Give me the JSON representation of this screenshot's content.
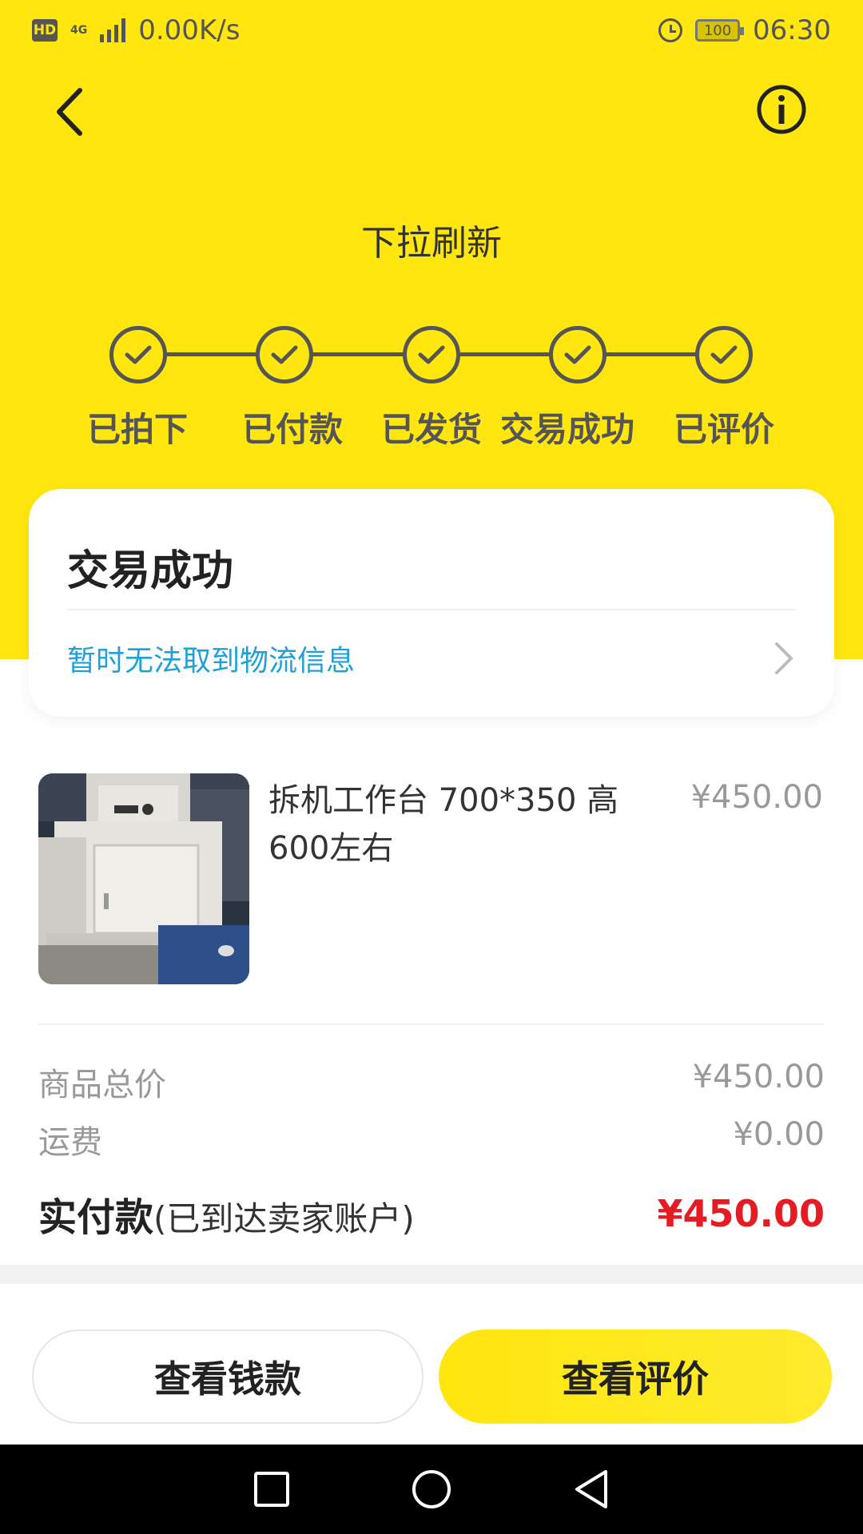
{
  "status_bar": {
    "hd": "HD",
    "network": "4G",
    "speed": "0.00K/s",
    "battery": "100",
    "time": "06:30"
  },
  "header": {
    "refresh_hint": "下拉刷新"
  },
  "progress": {
    "steps": [
      {
        "label": "已拍下",
        "done": true
      },
      {
        "label": "已付款",
        "done": true
      },
      {
        "label": "已发货",
        "done": true
      },
      {
        "label": "交易成功",
        "done": true
      },
      {
        "label": "已评价",
        "done": true
      }
    ]
  },
  "status_card": {
    "title": "交易成功",
    "logistics": "暂时无法取到物流信息"
  },
  "product": {
    "name": "拆机工作台 700*350 高600左右",
    "price": "¥450.00"
  },
  "fees": {
    "goods_total_label": "商品总价",
    "goods_total_value": "¥450.00",
    "shipping_label": "运费",
    "shipping_value": "¥0.00",
    "paid_label": "实付款",
    "paid_note": "(已到达卖家账户)",
    "paid_value": "¥450.00"
  },
  "actions": {
    "view_money": "查看钱款",
    "view_review": "查看评价"
  },
  "colors": {
    "brand_yellow": "#FFE60F",
    "link_blue": "#1FA0D8",
    "price_red": "#E51C23"
  }
}
